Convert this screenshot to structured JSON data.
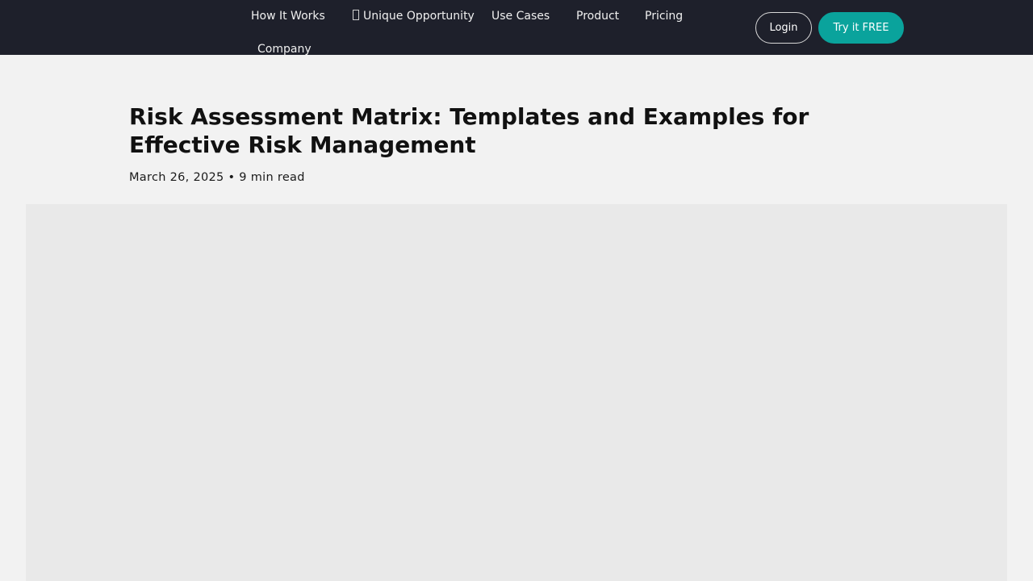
{
  "header": {
    "nav": [
      {
        "label": "How It Works"
      },
      {
        "label": "Unique Opportunity",
        "icon": "missing-glyph-icon"
      },
      {
        "label": "Use Cases"
      },
      {
        "label": "Product"
      },
      {
        "label": "Pricing"
      },
      {
        "label": "Company"
      }
    ],
    "login_label": "Login",
    "cta_label": "Try it FREE"
  },
  "article": {
    "title": "Risk Assessment Matrix: Templates and Examples for Effective Risk Management",
    "date": "March 26, 2025",
    "separator": "•",
    "read_time": "9 min read"
  },
  "colors": {
    "header_bg": "#1e202b",
    "accent": "#0aa39c",
    "page_bg": "#f2f2f2",
    "hero_bg": "#e9e9e9"
  }
}
